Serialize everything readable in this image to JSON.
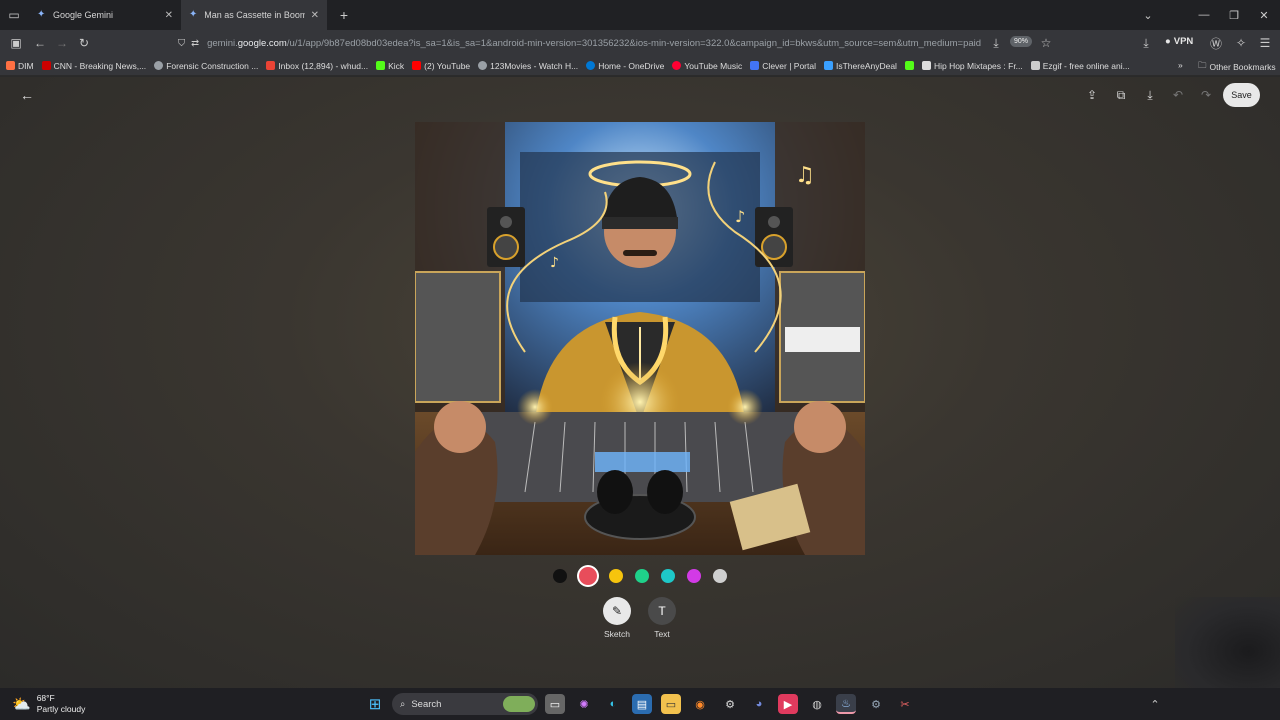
{
  "browser": {
    "tabs": [
      {
        "title": "Google Gemini"
      },
      {
        "title": "Man as Cassette in Boom Box"
      }
    ],
    "url": {
      "prefix": "gemini.",
      "host": "google.com",
      "path": "/u/1/app/9b87ed08bd03edea?is_sa=1&is_sa=1&android-min-version=301356232&ios-min-version=322.0&campaign_id=bkws&utm_source=sem&utm_medium=paid"
    },
    "zoom": "90%",
    "vpn_label": "VPN",
    "bookmarks": [
      {
        "label": "DIM",
        "color": "#ff7043"
      },
      {
        "label": "CNN - Breaking News,...",
        "color": "#cc0000"
      },
      {
        "label": "Forensic Construction ...",
        "color": "#9aa0a6"
      },
      {
        "label": "Inbox (12,894) - whud...",
        "color": "#ea4335"
      },
      {
        "label": "Kick",
        "color": "#53fc18"
      },
      {
        "label": "(2) YouTube",
        "color": "#ff0000"
      },
      {
        "label": "123Movies - Watch H...",
        "color": "#9aa0a6"
      },
      {
        "label": "Home - OneDrive",
        "color": "#0078d4"
      },
      {
        "label": "YouTube Music",
        "color": "#ff0033"
      },
      {
        "label": "Clever | Portal",
        "color": "#4274f6"
      },
      {
        "label": "IsThereAnyDeal",
        "color": "#3aa0ff"
      },
      {
        "label": "",
        "color": "#53fc18"
      },
      {
        "label": "Hip Hop Mixtapes : Fr...",
        "color": "#dddddd"
      },
      {
        "label": "Ezgif - free online ani...",
        "color": "#cccccc"
      }
    ],
    "other_bookmarks": "Other Bookmarks"
  },
  "editor": {
    "save_label": "Save",
    "palette": [
      "#111111",
      "#e84d5b",
      "#f6c40d",
      "#1fd18a",
      "#1ec8c8",
      "#d23ae6",
      "#cfcfcf"
    ],
    "selected_color": "#e84d5b",
    "tools": [
      {
        "label": "Sketch",
        "icon": "pen-icon"
      },
      {
        "label": "Text",
        "icon": "text-icon"
      }
    ]
  },
  "taskbar": {
    "weather": {
      "temp": "68°F",
      "condition": "Partly cloudy"
    },
    "search_label": "Search"
  }
}
